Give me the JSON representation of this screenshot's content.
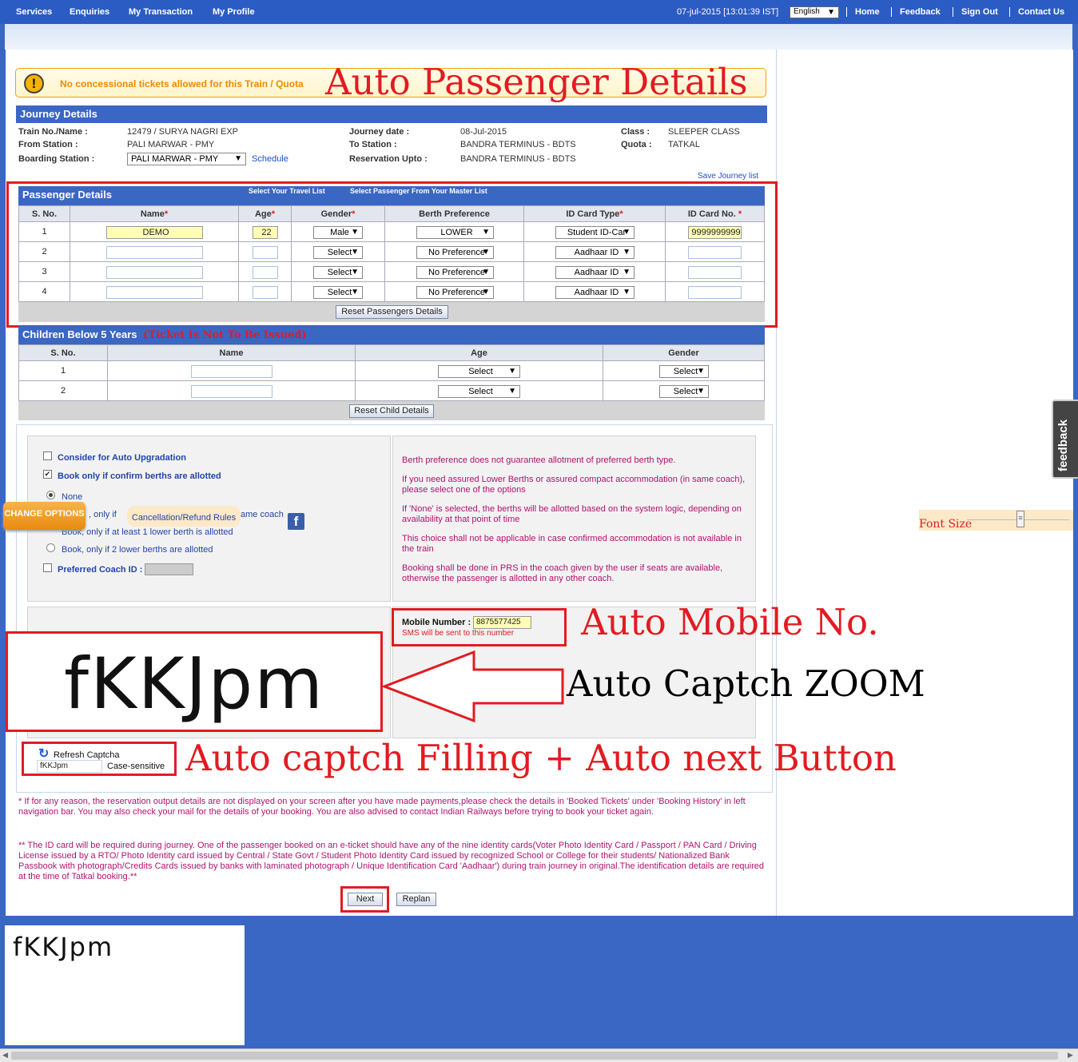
{
  "nav": {
    "left": [
      "Services",
      "Enquiries",
      "My Transaction",
      "My Profile"
    ],
    "datetime": "07-jul-2015 [13:01:39 IST]",
    "language": "English",
    "right": [
      "Home",
      "Feedback",
      "Sign Out",
      "Contact Us"
    ]
  },
  "warning": {
    "text": "No concessional tickets allowed for this Train / Quota"
  },
  "annotations": {
    "passenger": "Auto Passenger Details",
    "mobile": "Auto Mobile No.",
    "captcha_zoom": "Auto Captch ZOOM",
    "captcha_fill": "Auto captch Filling + Auto next Button"
  },
  "journey": {
    "title": "Journey Details",
    "train_label": "Train No./Name :",
    "train": "12479 / SURYA NAGRI EXP",
    "from_label": "From Station :",
    "from": "PALI MARWAR - PMY",
    "boarding_label": "Boarding Station :",
    "boarding": "PALI MARWAR - PMY",
    "schedule": "Schedule",
    "date_label": "Journey date :",
    "date": "08-Jul-2015",
    "to_label": "To Station :",
    "to": "BANDRA TERMINUS - BDTS",
    "upto_label": "Reservation Upto :",
    "upto": "BANDRA TERMINUS - BDTS",
    "class_label": "Class :",
    "class": "SLEEPER CLASS",
    "quota_label": "Quota :",
    "quota": "TATKAL",
    "save_list": "Save Journey list"
  },
  "passengers": {
    "title": "Passenger Details",
    "travel_list": "Select Your Travel List",
    "master_list": "Select Passenger From Your Master List",
    "headers": [
      "S. No.",
      "Name",
      "Age",
      "Gender",
      "Berth Preference",
      "ID Card Type",
      "ID Card No."
    ],
    "required_mark": "*",
    "rows": [
      {
        "sno": "1",
        "name": "DEMO",
        "age": "22",
        "gender": "Male",
        "berth": "LOWER",
        "idtype": "Student ID-Car",
        "idno": "9999999999"
      },
      {
        "sno": "2",
        "name": "",
        "age": "",
        "gender": "Select",
        "berth": "No Preference",
        "idtype": "Aadhaar ID",
        "idno": ""
      },
      {
        "sno": "3",
        "name": "",
        "age": "",
        "gender": "Select",
        "berth": "No Preference",
        "idtype": "Aadhaar ID",
        "idno": ""
      },
      {
        "sno": "4",
        "name": "",
        "age": "",
        "gender": "Select",
        "berth": "No Preference",
        "idtype": "Aadhaar ID",
        "idno": ""
      }
    ],
    "reset": "Reset Passengers Details"
  },
  "children": {
    "title": "Children Below 5 Years",
    "note": "(Ticket Is Not To Be Issued)",
    "headers": [
      "S. No.",
      "Name",
      "Age",
      "Gender"
    ],
    "rows": [
      {
        "sno": "1",
        "age": "Select",
        "gender": "Select"
      },
      {
        "sno": "2",
        "age": "Select",
        "gender": "Select"
      }
    ],
    "reset": "Reset Child Details"
  },
  "options": {
    "auto_upgrade": "Consider for Auto Upgradation",
    "confirm_only": "Book only if confirm berths are allotted",
    "none": "None",
    "same_coach": ", only if",
    "same_coach_tail": "ame coach",
    "one_lower": "Book, only if at least 1 lower berth is allotted",
    "two_lower": "Book, only if 2 lower berths are allotted",
    "coach_id": "Preferred Coach ID :",
    "change_options": "CHANGE OPTIONS",
    "refund_rules": "Cancellation/Refund Rules",
    "fb": "f"
  },
  "berth_notes": [
    "Berth preference does not guarantee allotment of preferred berth type.",
    "If you need assured Lower Berths or assured compact accommodation (in same coach), please select one of the options",
    "If 'None' is selected, the berths will be allotted based on the system logic, depending on availability at that point of time",
    "This choice shall not be applicable in case confirmed accommodation is not available in the train",
    "Booking shall be done in PRS in the coach given by the user if seats are available, otherwise the passenger is allotted in any other coach."
  ],
  "mobile": {
    "label": "Mobile Number :",
    "value": "8875577425",
    "note": "SMS will be sent to this number"
  },
  "captcha": {
    "image_text": "fKKJpm",
    "refresh": "Refresh Captcha",
    "input": "fKKJpm",
    "case": "Case-sensitive"
  },
  "footnotes": [
    "* If for any reason, the reservation output details are not displayed on your screen after you have made payments,please check the details in 'Booked Tickets' under 'Booking History' in left navigation bar. You may also check your mail for the details of your booking. You are also advised to contact Indian Railways before trying to book your ticket again.",
    "** The ID card will be required during journey. One of the passenger booked on an e-ticket should have any of the nine identity cards(Voter Photo Identity Card / Passport / PAN Card / Driving License issued by a RTO/ Photo Identity card issued by Central / State Govt / Student Photo Identity Card issued by recognized School or College for their students/ Nationalized Bank Passbook with photograph/Credits Cards issued by banks with laminated photograph / Unique Identification Card 'Aadhaar') during train journey in original.The identification details are required at the time of Tatkal booking.**"
  ],
  "buttons": {
    "next": "Next",
    "replan": "Replan"
  },
  "side": {
    "feedback": "feedback",
    "font_size": "Font Size"
  },
  "bottom_text": "fKKJpm"
}
